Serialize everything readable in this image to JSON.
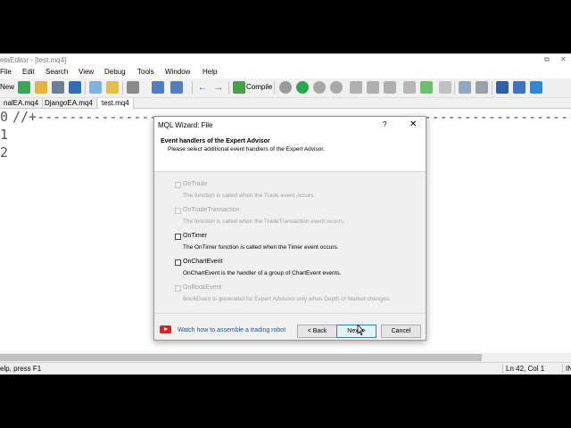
{
  "window": {
    "title": "etaEditor - [test.mq4]",
    "restore_glyph": "⧉",
    "close_glyph": "✕"
  },
  "menu": [
    "File",
    "Edit",
    "Search",
    "View",
    "Debug",
    "Tools",
    "Window",
    "Help"
  ],
  "toolbar": {
    "new_label": "New",
    "compile_label": "Compile"
  },
  "tabs": [
    {
      "label": "nalEA.mq4",
      "active": false
    },
    {
      "label": "DjangoEA.mq4",
      "active": false
    },
    {
      "label": "test.mq4",
      "active": true
    }
  ],
  "editor": {
    "line_numbers": [
      "0",
      "1",
      "2"
    ],
    "first_line": "//+---------------------------------------------------------------------------------"
  },
  "status": {
    "help": "elp, press F1",
    "position": "Ln 42, Col 1",
    "mode": "IN"
  },
  "dialog": {
    "title": "MQL Wizard: File",
    "help_glyph": "?",
    "close_glyph": "✕",
    "heading": "Event handlers of the Expert Advisor",
    "subheading": "Please select additional event handlers of the Expert Advisor.",
    "options": [
      {
        "name": "OnTrade",
        "desc": "The function is called when the Trade event occurs.",
        "enabled": false,
        "checked": false
      },
      {
        "name": "OnTradeTransaction",
        "desc": "The function is called when the TradeTransaction event occurs.",
        "enabled": false,
        "checked": false
      },
      {
        "name": "OnTimer",
        "desc": "The OnTimer function is called when the Timer event occurs.",
        "enabled": true,
        "checked": false
      },
      {
        "name": "OnChartEvent",
        "desc": "OnChartEvent is the handler of a group of ChartEvent events.",
        "enabled": true,
        "checked": false
      },
      {
        "name": "OnBookEvent",
        "desc": "BookEvent is generated for Expert Advisors only when Depth of Market changes.",
        "enabled": false,
        "checked": false
      }
    ],
    "video_link": "Watch how to assemble a trading robot",
    "back_label": "< Back",
    "next_label": "Next >",
    "cancel_label": "Cancel"
  },
  "colors": {
    "accent": "#3c7fb1",
    "link": "#1a56a6",
    "youtube": "#e0201b",
    "disabled_text": "#a0a0a0"
  }
}
